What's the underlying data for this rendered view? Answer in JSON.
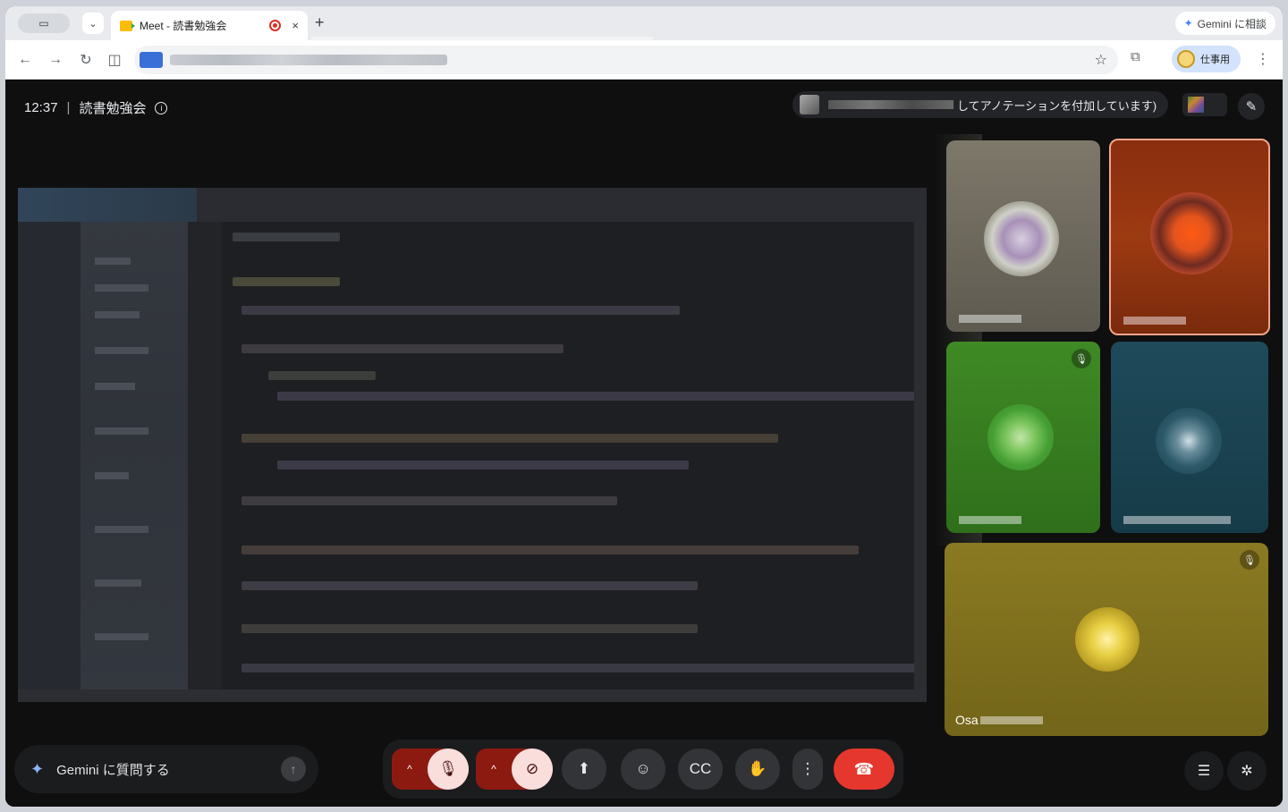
{
  "browser": {
    "tab_title": "Meet - 読書勉強会",
    "tab_close": "×",
    "new_tab": "+",
    "gemini_button": "Gemini に相談",
    "profile_label": "仕事用"
  },
  "meeting": {
    "time": "12:37",
    "separator": "|",
    "name": "読書勉強会",
    "annotation_text": "してアノテーションを付加しています)"
  },
  "participants": [
    {
      "name_prefix": "",
      "muted": false,
      "color": "#6b665a"
    },
    {
      "name_prefix": "",
      "muted": false,
      "active_speaker": true,
      "color": "#9c3a12"
    },
    {
      "name_prefix": "",
      "muted": true,
      "color": "#2f6f1b"
    },
    {
      "name_prefix": "",
      "muted": false,
      "color": "#163b48"
    },
    {
      "name_prefix": "Osa",
      "muted": true,
      "color": "#736519"
    }
  ],
  "gemini_prompt": {
    "placeholder": "Gemini に質問する"
  },
  "colors": {
    "end_call": "#e5372d",
    "mic_off_bg": "#f9dedc",
    "active_speaker_border": "#f2a48a"
  }
}
